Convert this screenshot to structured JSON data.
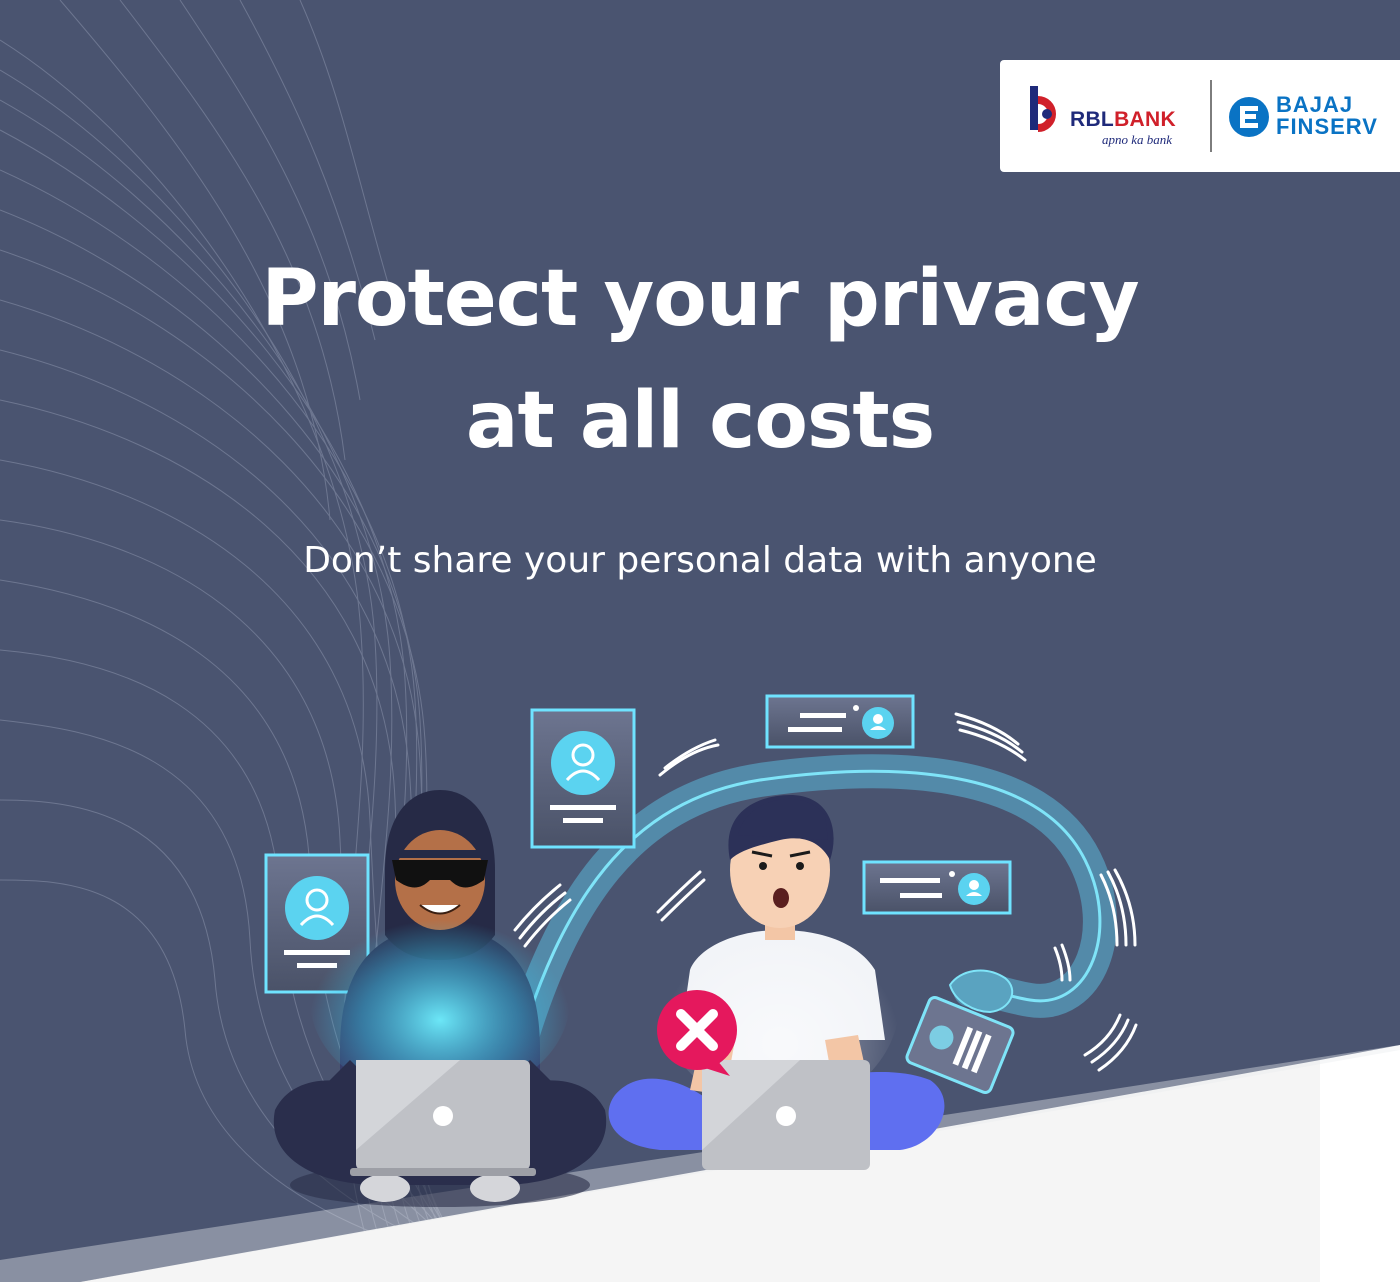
{
  "header": {
    "rbl_logo": {
      "name_part1": "RBL",
      "name_part2": "BANK",
      "tagline": "apno ka bank"
    },
    "bajaj_logo": {
      "line1": "BAJAJ",
      "line2": "FINSERV"
    }
  },
  "hero": {
    "title_line1": "Protect your privacy",
    "title_line2": "at all costs",
    "subtitle": "Don’t share your personal data with anyone"
  },
  "colors": {
    "background": "#4a5470",
    "accent": "#5bd3f0",
    "warning": "#e5185d",
    "rbl_navy": "#1f2a7a",
    "rbl_red": "#d0202a",
    "bajaj_blue": "#0a73c4"
  },
  "icons": [
    "profile-card-icon",
    "warning-x-icon",
    "laptop-icon",
    "id-card-icon"
  ]
}
